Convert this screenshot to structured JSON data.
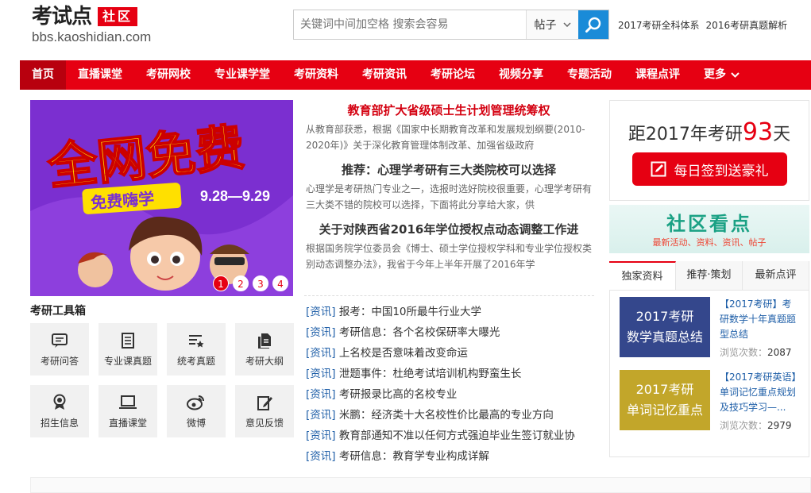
{
  "header": {
    "logo_main": "考试点",
    "logo_badge": "社区",
    "logo_url": "bbs.kaoshidian.com",
    "search_placeholder": "关键词中间加空格 搜索会容易",
    "search_type": "帖子",
    "hot_links": [
      "2017考研全科体系",
      "2016考研真题解析"
    ]
  },
  "nav": {
    "items": [
      "首页",
      "直播课堂",
      "考研网校",
      "专业课学堂",
      "考研资料",
      "考研资讯",
      "考研论坛",
      "视频分享",
      "专题活动",
      "课程点评",
      "更多"
    ]
  },
  "banner": {
    "headline": "全网免费",
    "subline": "免费嗨学",
    "date": "9.28—9.29",
    "dots": [
      "1",
      "2",
      "3",
      "4"
    ]
  },
  "news": [
    {
      "title": "教育部扩大省级硕士生计划管理统筹权",
      "desc": "从教育部获悉，根据《国家中长期教育改革和发展规划纲要(2010-2020年)》关于深化教育管理体制改革、加强省级政府"
    },
    {
      "title": "推荐：心理学考研有三大类院校可以选择",
      "desc": "心理学是考研热门专业之一，选报时选好院校很重要，心理学考研有三大类不错的院校可以选择，下面将此分享给大家，供"
    },
    {
      "title": "关于对陕西省2016年学位授权点动态调整工作进",
      "desc": "根据国务院学位委员会《博士、硕士学位授权学科和专业学位授权类别动态调整办法》，我省于今年上半年开展了2016年学"
    }
  ],
  "list": [
    {
      "tag": "[资讯]",
      "text": "报考：中国10所最牛行业大学"
    },
    {
      "tag": "[资讯]",
      "text": "考研信息：各个名校保研率大曝光"
    },
    {
      "tag": "[资讯]",
      "text": "上名校是否意味着改变命运"
    },
    {
      "tag": "[资讯]",
      "text": "泄题事件：杜绝考试培训机构野蛮生长"
    },
    {
      "tag": "[资讯]",
      "text": "考研报录比高的名校专业"
    },
    {
      "tag": "[资讯]",
      "text": "米鹏：经济类十大名校性价比最高的专业方向"
    },
    {
      "tag": "[资讯]",
      "text": "教育部通知不准以任何方式强迫毕业生签订就业协"
    },
    {
      "tag": "[资讯]",
      "text": "考研信息：教育学专业构成详解"
    }
  ],
  "tools": {
    "title": "考研工具箱",
    "items": [
      "考研问答",
      "专业课真题",
      "统考真题",
      "考研大纲",
      "招生信息",
      "直播课堂",
      "微博",
      "意见反馈"
    ]
  },
  "right": {
    "countdown_prefix": "距2017年考研",
    "countdown_days": "93",
    "countdown_suffix": "天",
    "signin_label": "每日签到送豪礼",
    "kandian_title": "社区看点",
    "kandian_sub": "最新活动、资料、资讯、帖子",
    "tabs": [
      "独家资料",
      "推荐·策划",
      "最新点评"
    ],
    "cards": [
      {
        "img_text": "2017考研\n数学真题总结",
        "title": "【2017考研】考研数学十年真题题型总结",
        "views_label": "浏览次数：",
        "views": "2087",
        "color": "#34478c"
      },
      {
        "img_text": "2017考研\n单词记忆重点",
        "title": "【2017考研英语】单词记忆重点规划及技巧学习—...",
        "views_label": "浏览次数：",
        "views": "2979",
        "color": "#c2a62a"
      }
    ]
  }
}
